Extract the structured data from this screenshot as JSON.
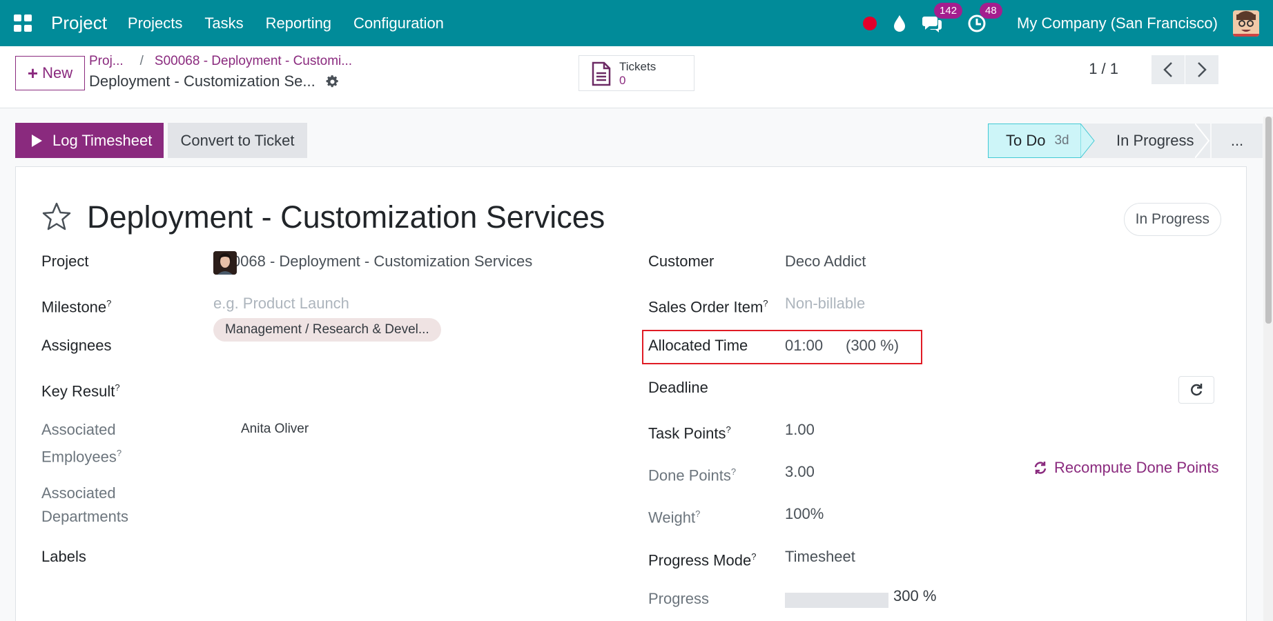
{
  "navbar": {
    "app_name": "Project",
    "menu": [
      "Projects",
      "Tasks",
      "Reporting",
      "Configuration"
    ],
    "chat_count": "142",
    "activity_count": "48",
    "company": "My Company (San Francisco)"
  },
  "control_panel": {
    "new_label": "New",
    "breadcrumb": [
      "Proj...",
      "S00068 - Deployment - Customi..."
    ],
    "record_title": "Deployment - Customization Se...",
    "tickets_label": "Tickets",
    "tickets_count": "0",
    "pager": "1 / 1"
  },
  "status_bar": {
    "log_timesheet": "Log Timesheet",
    "convert_to_ticket": "Convert to Ticket",
    "stage_todo": "To Do",
    "stage_todo_days": "3d",
    "stage_in_progress": "In Progress",
    "stage_more": "..."
  },
  "form": {
    "title": "Deployment - Customization Services",
    "state": "In Progress",
    "left": {
      "project_label": "Project",
      "project_value": "S00068 - Deployment - Customization Services",
      "milestone_label": "Milestone",
      "milestone_placeholder": "e.g. Product Launch",
      "assignees_label": "Assignees",
      "key_result_label": "Key Result",
      "assoc_employees_label_1": "Associated",
      "assoc_employees_label_2": "Employees",
      "employee_name": "Anita Oliver",
      "assoc_departments_label_1": "Associated",
      "assoc_departments_label_2": "Departments",
      "department_tag": "Management / Research & Devel...",
      "labels_label": "Labels"
    },
    "right": {
      "customer_label": "Customer",
      "customer_value": "Deco Addict",
      "so_item_label": "Sales Order Item",
      "so_item_placeholder": "Non-billable",
      "allocated_time_label": "Allocated Time",
      "allocated_time_value": "01:00",
      "allocated_time_percent": "(300 %)",
      "deadline_label": "Deadline",
      "task_points_label": "Task Points",
      "task_points_value": "1.00",
      "done_points_label": "Done Points",
      "done_points_value": "3.00",
      "recompute_label": "Recompute Done Points",
      "weight_label": "Weight",
      "weight_value": "100%",
      "progress_mode_label": "Progress Mode",
      "progress_mode_value": "Timesheet",
      "progress_label": "Progress",
      "progress_value": "300 %"
    },
    "help_mark": "?"
  },
  "colors": {
    "navbar": "#018b99",
    "primary": "#8a2a7e",
    "highlight": "#e01b24",
    "stage_active": "#cdf5f8"
  }
}
